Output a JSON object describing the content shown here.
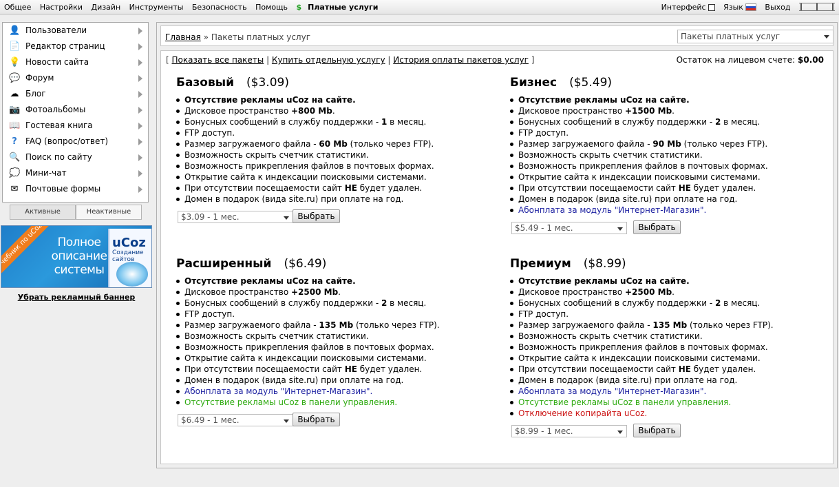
{
  "topbar": {
    "menu": [
      "Общее",
      "Настройки",
      "Дизайн",
      "Инструменты",
      "Безопасность",
      "Помощь"
    ],
    "paid_services": "Платные услуги",
    "interface_label": "Интерфейс",
    "language_label": "Язык",
    "logout_label": "Выход"
  },
  "sidebar": {
    "items": [
      {
        "label": "Пользователи",
        "icon": "users-icon"
      },
      {
        "label": "Редактор страниц",
        "icon": "page-editor-icon"
      },
      {
        "label": "Новости сайта",
        "icon": "news-icon"
      },
      {
        "label": "Форум",
        "icon": "forum-icon"
      },
      {
        "label": "Блог",
        "icon": "blog-icon"
      },
      {
        "label": "Фотоальбомы",
        "icon": "camera-icon"
      },
      {
        "label": "Гостевая книга",
        "icon": "guestbook-icon"
      },
      {
        "label": "FAQ (вопрос/ответ)",
        "icon": "faq-icon"
      },
      {
        "label": "Поиск по сайту",
        "icon": "search-icon"
      },
      {
        "label": "Мини-чат",
        "icon": "chat-icon"
      },
      {
        "label": "Почтовые формы",
        "icon": "mail-icon"
      }
    ],
    "tab_active": "Активные",
    "tab_inactive": "Неактивные"
  },
  "banner": {
    "ribbon": "Учебник по uCoz",
    "headline": "Полное описание системы",
    "book_title": "uCoz",
    "book_subtitle": "Создание сайтов",
    "remove_link": "Убрать рекламный баннер"
  },
  "breadcrumb": {
    "home": "Главная",
    "separator": "»",
    "current": "Пакеты платных услуг"
  },
  "section_select": {
    "value": "Пакеты платных услуг"
  },
  "links": {
    "show_all": "Показать все пакеты",
    "buy_single": "Купить отдельную услугу",
    "history": "История оплаты пакетов услуг"
  },
  "balance": {
    "label": "Остаток на лицевом счете:",
    "amount": "$0.00"
  },
  "choose_button": "Выбрать",
  "colors": {
    "blue_feature": "#1b1fa0",
    "green_feature": "#2eaa10",
    "red_feature": "#cc1515"
  },
  "packages": [
    {
      "name": "Базовый",
      "price": "($3.09)",
      "period": "$3.09 - 1 мес.",
      "features": [
        {
          "pre": "",
          "bold": "Отсутствие рекламы uCoz на сайте.",
          "post": ""
        },
        {
          "pre": "Дисковое пространство ",
          "bold": "+800 Mb",
          "post": "."
        },
        {
          "pre": "Бонусных сообщений в службу поддержки - ",
          "bold": "1",
          "post": " в месяц."
        },
        {
          "pre": "FTP доступ.",
          "bold": "",
          "post": ""
        },
        {
          "pre": "Размер загружаемого файла - ",
          "bold": "60 Mb",
          "post": " (только через FTP)."
        },
        {
          "pre": "Возможность скрыть счетчик статистики.",
          "bold": "",
          "post": ""
        },
        {
          "pre": "Возможность прикрепления файлов в почтовых формах.",
          "bold": "",
          "post": ""
        },
        {
          "pre": "Открытие сайта к индексации поисковыми системами.",
          "bold": "",
          "post": ""
        },
        {
          "pre": "При отсутствии посещаемости сайт ",
          "bold": "НЕ",
          "post": " будет удален."
        },
        {
          "pre": "Домен в подарок (вида site.ru) при оплате на год.",
          "bold": "",
          "post": ""
        }
      ]
    },
    {
      "name": "Бизнес",
      "price": "($5.49)",
      "period": "$5.49 - 1 мес.",
      "features": [
        {
          "pre": "",
          "bold": "Отсутствие рекламы uCoz на сайте.",
          "post": ""
        },
        {
          "pre": "Дисковое пространство ",
          "bold": "+1500 Mb",
          "post": "."
        },
        {
          "pre": "Бонусных сообщений в службу поддержки - ",
          "bold": "2",
          "post": " в месяц."
        },
        {
          "pre": "FTP доступ.",
          "bold": "",
          "post": ""
        },
        {
          "pre": "Размер загружаемого файла - ",
          "bold": "90 Mb",
          "post": " (только через FTP)."
        },
        {
          "pre": "Возможность скрыть счетчик статистики.",
          "bold": "",
          "post": ""
        },
        {
          "pre": "Возможность прикрепления файлов в почтовых формах.",
          "bold": "",
          "post": ""
        },
        {
          "pre": "Открытие сайта к индексации поисковыми системами.",
          "bold": "",
          "post": ""
        },
        {
          "pre": "При отсутствии посещаемости сайт ",
          "bold": "НЕ",
          "post": " будет удален."
        },
        {
          "pre": "Домен в подарок (вида site.ru) при оплате на год.",
          "bold": "",
          "post": ""
        },
        {
          "pre": "Абонплата за модуль \"Интернет-Магазин\".",
          "bold": "",
          "post": "",
          "color": "blue"
        }
      ]
    },
    {
      "name": "Расширенный",
      "price": "($6.49)",
      "period": "$6.49 - 1 мес.",
      "features": [
        {
          "pre": "",
          "bold": "Отсутствие рекламы uCoz на сайте.",
          "post": ""
        },
        {
          "pre": "Дисковое пространство ",
          "bold": "+2500 Mb",
          "post": "."
        },
        {
          "pre": "Бонусных сообщений в службу поддержки - ",
          "bold": "2",
          "post": " в месяц."
        },
        {
          "pre": "FTP доступ.",
          "bold": "",
          "post": ""
        },
        {
          "pre": "Размер загружаемого файла - ",
          "bold": "135 Mb",
          "post": " (только через FTP)."
        },
        {
          "pre": "Возможность скрыть счетчик статистики.",
          "bold": "",
          "post": ""
        },
        {
          "pre": "Возможность прикрепления файлов в почтовых формах.",
          "bold": "",
          "post": ""
        },
        {
          "pre": "Открытие сайта к индексации поисковыми системами.",
          "bold": "",
          "post": ""
        },
        {
          "pre": "При отсутствии посещаемости сайт ",
          "bold": "НЕ",
          "post": " будет удален."
        },
        {
          "pre": "Домен в подарок (вида site.ru) при оплате на год.",
          "bold": "",
          "post": ""
        },
        {
          "pre": "Абонплата за модуль \"Интернет-Магазин\".",
          "bold": "",
          "post": "",
          "color": "blue"
        },
        {
          "pre": "Отсутствие рекламы uCoz в панели управления.",
          "bold": "",
          "post": "",
          "color": "green"
        }
      ]
    },
    {
      "name": "Премиум",
      "price": "($8.99)",
      "period": "$8.99 - 1 мес.",
      "features": [
        {
          "pre": "",
          "bold": "Отсутствие рекламы uCoz на сайте.",
          "post": ""
        },
        {
          "pre": "Дисковое пространство ",
          "bold": "+2500 Mb",
          "post": "."
        },
        {
          "pre": "Бонусных сообщений в службу поддержки - ",
          "bold": "2",
          "post": " в месяц."
        },
        {
          "pre": "FTP доступ.",
          "bold": "",
          "post": ""
        },
        {
          "pre": "Размер загружаемого файла - ",
          "bold": "135 Mb",
          "post": " (только через FTP)."
        },
        {
          "pre": "Возможность скрыть счетчик статистики.",
          "bold": "",
          "post": ""
        },
        {
          "pre": "Возможность прикрепления файлов в почтовых формах.",
          "bold": "",
          "post": ""
        },
        {
          "pre": "Открытие сайта к индексации поисковыми системами.",
          "bold": "",
          "post": ""
        },
        {
          "pre": "При отсутствии посещаемости сайт ",
          "bold": "НЕ",
          "post": " будет удален."
        },
        {
          "pre": "Домен в подарок (вида site.ru) при оплате на год.",
          "bold": "",
          "post": ""
        },
        {
          "pre": "Абонплата за модуль \"Интернет-Магазин\".",
          "bold": "",
          "post": "",
          "color": "blue"
        },
        {
          "pre": "Отсутствие рекламы uCoz в панели управления.",
          "bold": "",
          "post": "",
          "color": "green"
        },
        {
          "pre": "Отключение копирайта uCoz.",
          "bold": "",
          "post": "",
          "color": "red"
        }
      ]
    }
  ]
}
